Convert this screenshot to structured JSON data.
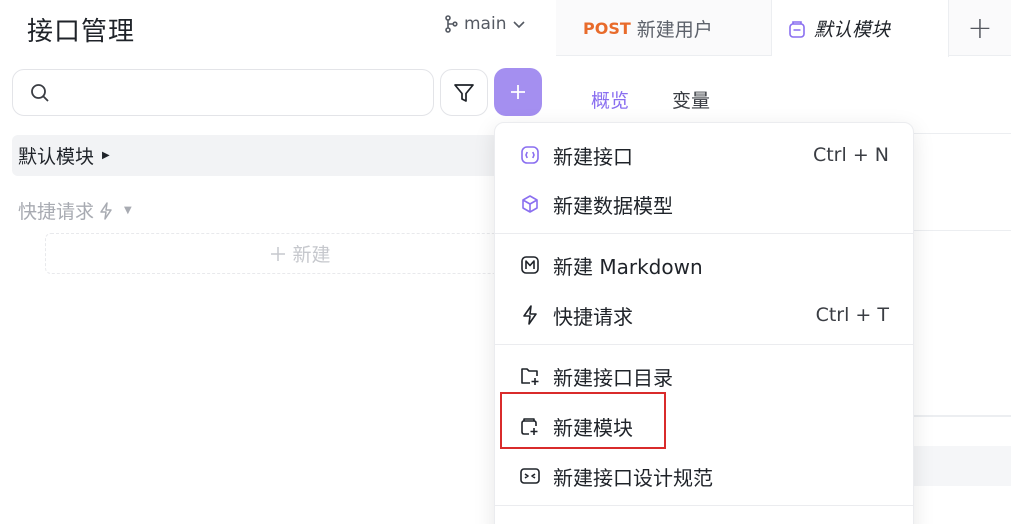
{
  "sidebar": {
    "title": "接口管理",
    "branch": "main",
    "search_placeholder": "",
    "tree": {
      "default_module": "默认模块",
      "quick_request": "快捷请求",
      "new_label": "新建"
    }
  },
  "tabs": {
    "post_method": "POST",
    "post_label": "新建用户",
    "active_label": "默认模块",
    "add_symbol": "+"
  },
  "subtabs": [
    "概览",
    "变量"
  ],
  "menu": {
    "items": [
      {
        "label": "新建接口",
        "shortcut": "Ctrl + N",
        "icon": "api-icon"
      },
      {
        "label": "新建数据模型",
        "shortcut": "",
        "icon": "cube-icon"
      },
      {
        "label": "新建 Markdown",
        "shortcut": "",
        "icon": "markdown-icon"
      },
      {
        "label": "快捷请求",
        "shortcut": "Ctrl + T",
        "icon": "bolt-icon"
      },
      {
        "label": "新建接口目录",
        "shortcut": "",
        "icon": "folder-add-icon"
      },
      {
        "label": "新建模块",
        "shortcut": "",
        "icon": "module-add-icon"
      },
      {
        "label": "新建接口设计规范",
        "shortcut": "",
        "icon": "spec-icon"
      }
    ]
  },
  "colors": {
    "accent": "#a48ff0",
    "accent_text": "#8a6ff0",
    "post_method": "#e86b2b",
    "highlight_border": "#d92b2b"
  }
}
